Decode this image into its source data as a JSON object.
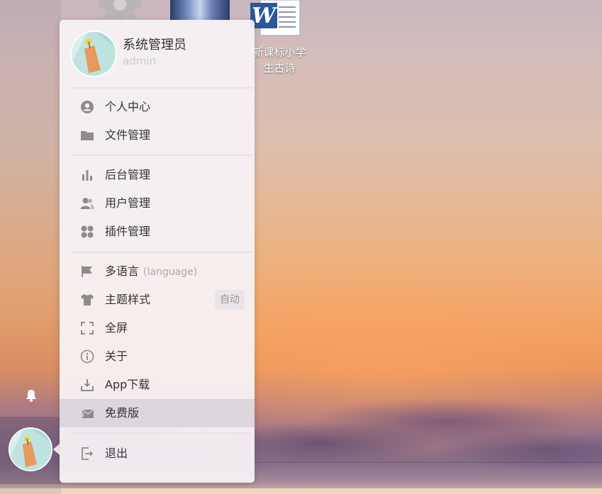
{
  "desktop": {
    "icons": [
      {
        "name": "gear-icon"
      },
      {
        "name": "photo-thumbnail"
      },
      {
        "name": "word-document-icon",
        "label": "新课标小学生古诗"
      }
    ]
  },
  "taskbar": {
    "bell_icon": "bell-icon"
  },
  "user": {
    "name": "系统管理员",
    "id": "admin"
  },
  "menu": {
    "groups": [
      {
        "items": [
          {
            "icon": "user-circle-icon",
            "label": "个人中心"
          },
          {
            "icon": "folder-icon",
            "label": "文件管理"
          }
        ]
      },
      {
        "items": [
          {
            "icon": "bar-chart-icon",
            "label": "后台管理"
          },
          {
            "icon": "users-icon",
            "label": "用户管理"
          },
          {
            "icon": "plugin-icon",
            "label": "插件管理"
          }
        ]
      },
      {
        "items": [
          {
            "icon": "flag-icon",
            "label": "多语言",
            "hint": "(language)"
          },
          {
            "icon": "tshirt-icon",
            "label": "主题样式",
            "badge": "自动"
          },
          {
            "icon": "fullscreen-icon",
            "label": "全屏"
          },
          {
            "icon": "info-icon",
            "label": "关于"
          },
          {
            "icon": "download-icon",
            "label": "App下载"
          },
          {
            "icon": "mail-icon",
            "label": "免费版",
            "active": true
          }
        ]
      },
      {
        "items": [
          {
            "icon": "logout-icon",
            "label": "退出"
          }
        ]
      }
    ]
  },
  "colors": {
    "icon_gray": "#8c8c8c",
    "text": "#333333",
    "hover_bg": "#dcd7dc"
  }
}
